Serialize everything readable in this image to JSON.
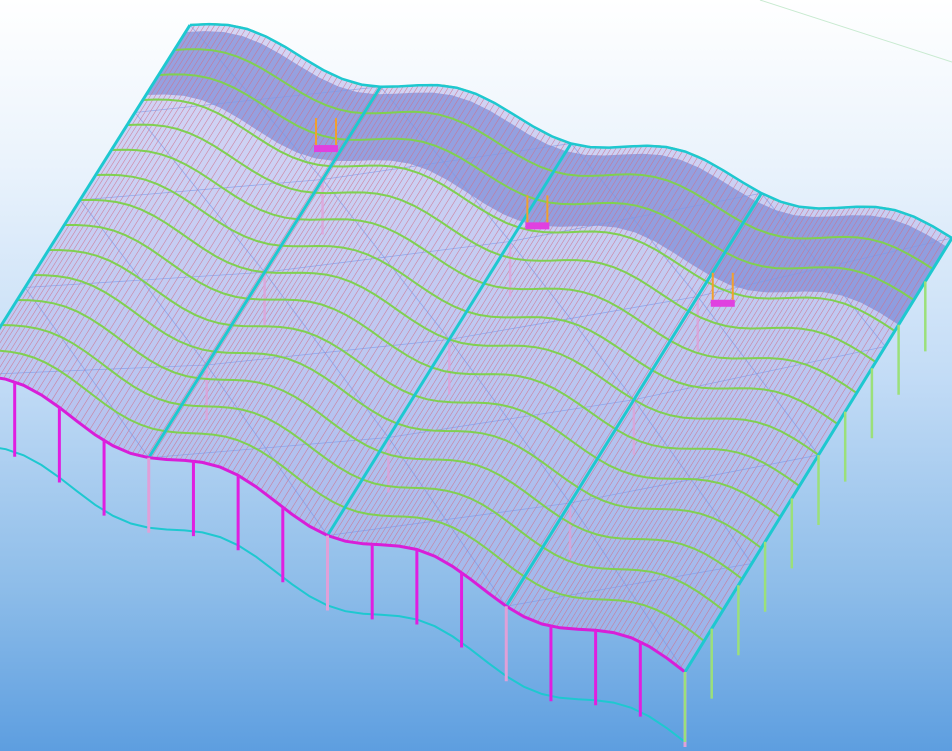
{
  "viewport": {
    "background_top": "#ffffff",
    "background_bottom": "#5d9ee0"
  },
  "model": {
    "description_icon": "steel-frame-3d-model",
    "colors": {
      "edge_beam": "#1ec8d0",
      "tall_column": "#e01ee0",
      "short_column": "#9be07a",
      "pink_column": "#e0a0d8",
      "purlin": "#d0708a",
      "rafter": "#80d050",
      "roof_fill": "#b4b4ec",
      "raised_fill": "#6e7ed2",
      "bracing": "#7a9ae8",
      "perimeter_beam": "#d81ed8",
      "equipment": "#e040e0",
      "equipment_base": "#f0a030"
    }
  }
}
